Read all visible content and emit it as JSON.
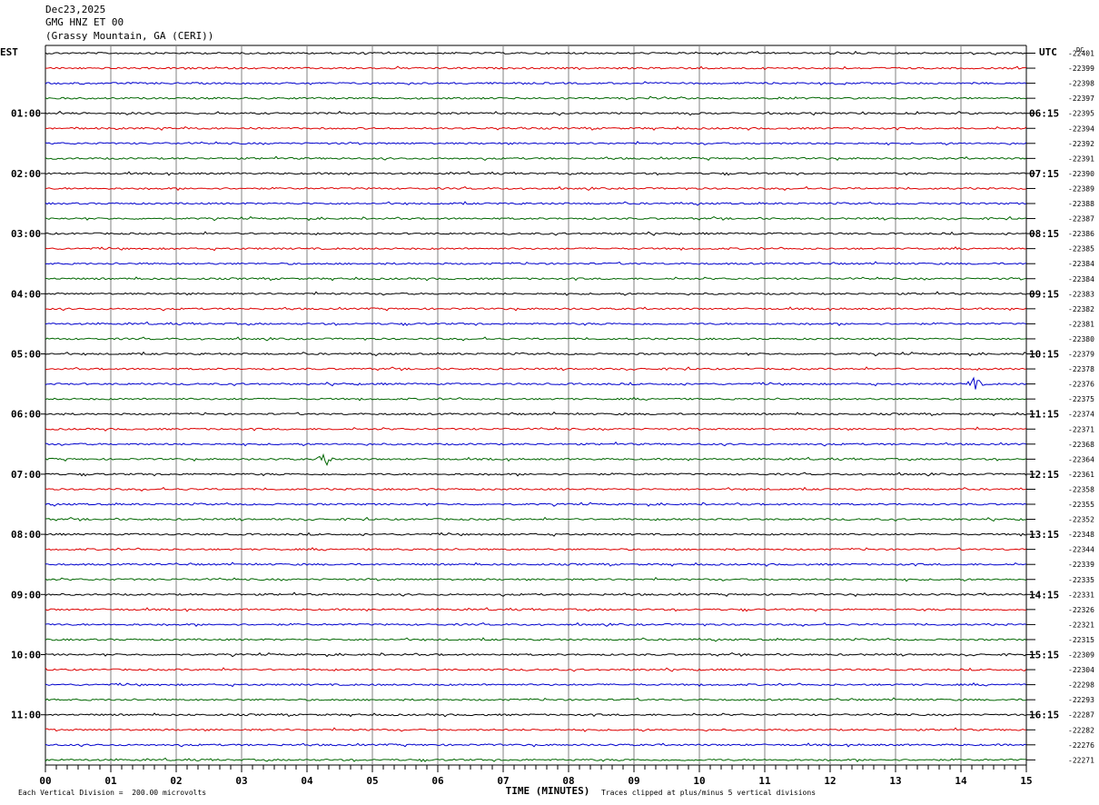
{
  "header": {
    "date": "Dec23,2025",
    "station": "GMG HNZ ET 00",
    "location": "(Grassy Mountain, GA (CERI))"
  },
  "chart_data": {
    "type": "line",
    "title": "",
    "xlabel": "TIME (MINUTES)",
    "xlim": [
      0,
      15
    ],
    "x_ticks": [
      "00",
      "01",
      "02",
      "03",
      "04",
      "05",
      "06",
      "07",
      "08",
      "09",
      "10",
      "11",
      "12",
      "13",
      "14",
      "15"
    ],
    "left_axis_title": "EST",
    "right_axis_title": "UTC",
    "dc_label": "DC",
    "est_hour_labels": [
      "01:00",
      "02:00",
      "03:00",
      "04:00",
      "05:00",
      "06:00",
      "07:00",
      "08:00",
      "09:00",
      "10:00",
      "11:00"
    ],
    "utc_hour_labels": [
      "06:15",
      "07:15",
      "08:15",
      "09:15",
      "10:15",
      "11:15",
      "12:15",
      "13:15",
      "14:15",
      "15:15",
      "16:15"
    ],
    "trace_colors": [
      "#000000",
      "#dd0000",
      "#0000cc",
      "#006600"
    ],
    "dc_offsets": [
      -22401,
      -22399,
      -22398,
      -22397,
      -22395,
      -22394,
      -22392,
      -22391,
      -22390,
      -22389,
      -22388,
      -22387,
      -22386,
      -22385,
      -22384,
      -22384,
      -22383,
      -22382,
      -22381,
      -22380,
      -22379,
      -22378,
      -22376,
      -22375,
      -22374,
      -22371,
      -22368,
      -22364,
      -22361,
      -22358,
      -22355,
      -22352,
      -22348,
      -22344,
      -22339,
      -22335,
      -22331,
      -22326,
      -22321,
      -22315,
      -22309,
      -22304,
      -22298,
      -22293,
      -22287,
      -22282,
      -22276,
      -22271
    ],
    "events": [
      {
        "trace": 22,
        "minute": 14.2
      },
      {
        "trace": 27,
        "minute": 4.3
      }
    ]
  },
  "footer": {
    "scale_note": "Each Vertical Division =  200.00 microvolts",
    "clip_note": "Traces clipped at plus/minus 5 vertical divisions"
  }
}
